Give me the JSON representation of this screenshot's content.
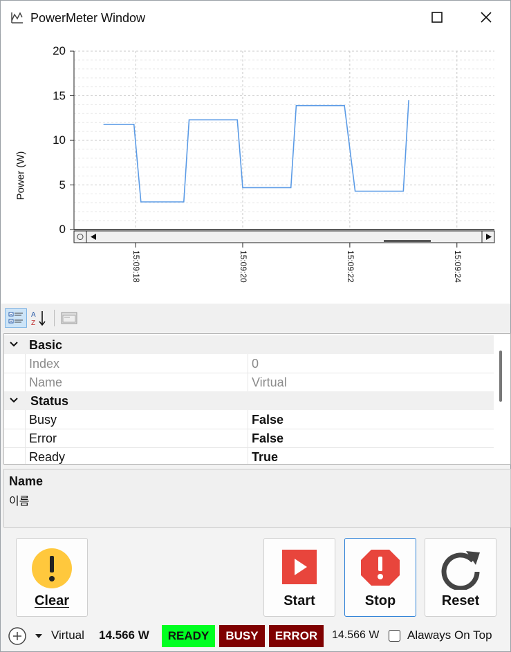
{
  "window": {
    "title": "PowerMeter Window"
  },
  "chart_data": {
    "type": "line",
    "title": "",
    "xlabel": "",
    "ylabel": "Power (W)",
    "ylim": [
      0,
      20
    ],
    "yticks": [
      "0",
      "5",
      "10",
      "15",
      "20"
    ],
    "xticks": [
      "15:09:18",
      "15:09:20",
      "15:09:22",
      "15:09:24"
    ],
    "series": [
      {
        "name": "",
        "color": "#5b9be6",
        "x": [
          "15:09:17.4",
          "15:09:17.97",
          "15:09:18.1",
          "15:09:18.9",
          "15:09:19.0",
          "15:09:19.9",
          "15:09:20.0",
          "15:09:20.9",
          "15:09:21.0",
          "15:09:21.9",
          "15:09:22.1",
          "15:09:23.0",
          "15:09:23.1"
        ],
        "y": [
          11.8,
          11.8,
          3.1,
          3.1,
          12.3,
          12.3,
          4.7,
          4.7,
          13.9,
          13.9,
          4.3,
          4.3,
          14.5
        ]
      }
    ],
    "grid": true,
    "legend": "none"
  },
  "toolbar": {
    "categorized_icon": "categorized-icon",
    "alphabetical_icon": "sort-az-icon",
    "property_pages_icon": "property-pages-icon"
  },
  "properties": {
    "categories": [
      {
        "name": "Basic",
        "rows": [
          {
            "key": "Index",
            "value": "0",
            "readonly": true
          },
          {
            "key": "Name",
            "value": "Virtual",
            "readonly": true
          }
        ]
      },
      {
        "name": "Status",
        "rows": [
          {
            "key": "Busy",
            "value": "False",
            "readonly": false
          },
          {
            "key": "Error",
            "value": "False",
            "readonly": false
          },
          {
            "key": "Ready",
            "value": "True",
            "readonly": false
          }
        ]
      }
    ]
  },
  "description": {
    "title": "Name",
    "text": "이름"
  },
  "buttons": {
    "clear": "Clear",
    "start": "Start",
    "stop": "Stop",
    "reset": "Reset"
  },
  "status": {
    "device": "Virtual",
    "power_bold": "14.566 W",
    "ready": "READY",
    "busy": "BUSY",
    "error": "ERROR",
    "power_plain": "14.566 W",
    "always_on_top": "Alaways On Top",
    "always_on_top_checked": false
  },
  "colors": {
    "ready_bg": "#00ff21",
    "busy_bg": "#7f0000",
    "error_bg": "#7f0000",
    "accent": "#2b7fd6",
    "line": "#5b9be6"
  }
}
